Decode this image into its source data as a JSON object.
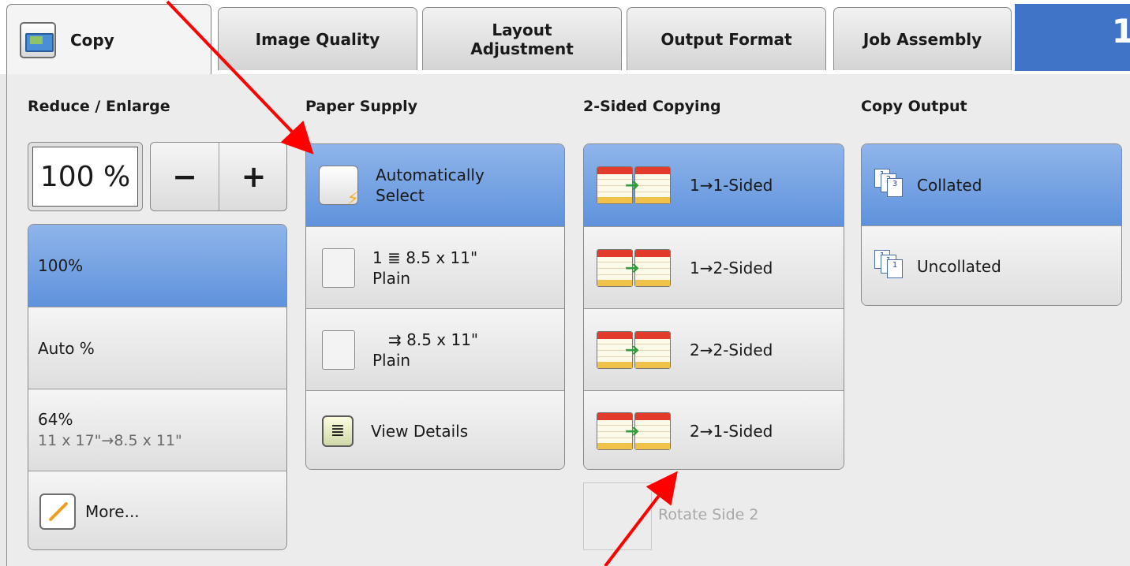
{
  "tabs": {
    "copy": "Copy",
    "image_quality": "Image Quality",
    "layout_line1": "Layout",
    "layout_line2": "Adjustment",
    "output_format": "Output Format",
    "job_assembly": "Job Assembly",
    "overflow": "1"
  },
  "reduce_enlarge": {
    "heading": "Reduce / Enlarge",
    "current_value": "100 %",
    "minus": "−",
    "plus": "+",
    "options": [
      {
        "label": "100%",
        "selected": true
      },
      {
        "label": "Auto %",
        "selected": false
      },
      {
        "label": "64%",
        "sub": "11 x 17\"→8.5 x 11\"",
        "selected": false
      },
      {
        "label": "More...",
        "selected": false
      }
    ]
  },
  "paper_supply": {
    "heading": "Paper Supply",
    "options": [
      {
        "line1": "Automatically",
        "line2": "Select",
        "selected": true
      },
      {
        "line1": "1  ≣  8.5 x 11\"",
        "line2": "Plain",
        "selected": false
      },
      {
        "line1": "⇉  8.5 x 11\"",
        "line2": "Plain",
        "selected": false
      },
      {
        "line1": "View Details",
        "selected": false
      }
    ]
  },
  "two_sided": {
    "heading": "2-Sided Copying",
    "options": [
      {
        "label": "1→1-Sided",
        "selected": true
      },
      {
        "label": "1→2-Sided",
        "selected": false
      },
      {
        "label": "2→2-Sided",
        "selected": false
      },
      {
        "label": "2→1-Sided",
        "selected": false
      }
    ],
    "rotate_label": "Rotate Side 2"
  },
  "copy_output": {
    "heading": "Copy Output",
    "options": [
      {
        "label": "Collated",
        "selected": true
      },
      {
        "label": "Uncollated",
        "selected": false
      }
    ]
  },
  "colors": {
    "selected": "#6f9fe2",
    "tab_strip": "#3f74c6",
    "annotation": "#ff0000"
  }
}
